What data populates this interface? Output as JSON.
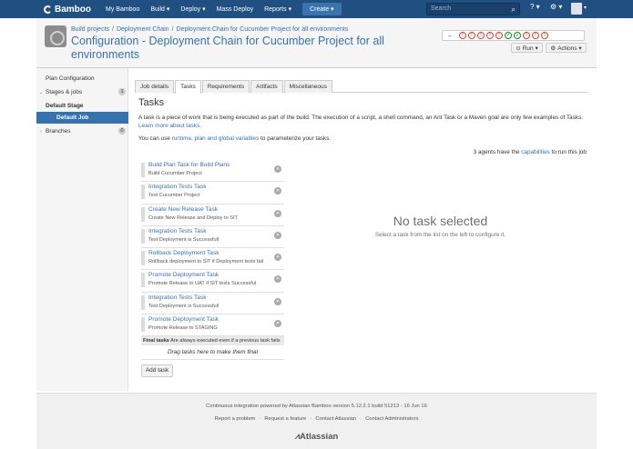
{
  "nav": {
    "logo": "Bamboo",
    "items": [
      "My Bamboo",
      "Build ▾",
      "Deploy ▾",
      "Mass Deploy",
      "Reports ▾"
    ],
    "create_label": "Create ▾",
    "search_placeholder": "Search",
    "help_label": "? ▾",
    "settings_label": "⚙ ▾"
  },
  "header": {
    "breadcrumb": [
      "Build projects",
      "Deployment Chain",
      "Deployment Chain for Cucumber Project for all environments"
    ],
    "title": "Configuration - Deployment Chain for Cucumber Project for all environments",
    "history_statuses": [
      "failed",
      "failed",
      "failed",
      "failed",
      "failed",
      "success",
      "success",
      "failed",
      "failed",
      "failed"
    ],
    "run_label": "Run ▾",
    "actions_label": "Actions ▾"
  },
  "sidebar": {
    "items": [
      {
        "label": "Plan Configuration",
        "badge": ""
      },
      {
        "label": "Stages & jobs",
        "badge": "1"
      },
      {
        "label": "Default Stage",
        "badge": ""
      },
      {
        "label": "Default Job",
        "badge": ""
      },
      {
        "label": "Branches",
        "badge": "0"
      }
    ]
  },
  "tabs": [
    "Job details",
    "Tasks",
    "Requirements",
    "Artifacts",
    "Miscellaneous"
  ],
  "active_tab": "Tasks",
  "main": {
    "title": "Tasks",
    "description": "A task is a piece of work that is being executed as part of the build. The execution of a script, a shell command, an Ant Task or a Maven goal are only few examples of Tasks.",
    "learn_more": "Learn more about tasks.",
    "variables_prefix": "You can use",
    "variables_link": "runtime, plan and global variables",
    "variables_suffix": "to parameterize your tasks.",
    "agents_prefix": "3 agents have the",
    "agents_link": "capabilities",
    "agents_suffix": "to run this job",
    "tasks": [
      {
        "name": "Build Plan Task for Build Plans",
        "desc": "Build Cucumber Project"
      },
      {
        "name": "Integration Tests Task",
        "desc": "Test Cucumber Project"
      },
      {
        "name": "Create New Release Task",
        "desc": "Create New Release and Deploy to SIT"
      },
      {
        "name": "Integration Tests Task",
        "desc": "Test Deployment is Successfull"
      },
      {
        "name": "Rollback Deployment Task",
        "desc": "Rollback deployment to SIT if Deployment tests fail"
      },
      {
        "name": "Promote Deployment Task",
        "desc": "Promote Release to UAT if SIT tests Successful"
      },
      {
        "name": "Integration Tests Task",
        "desc": "Test Deployment is Successfull"
      },
      {
        "name": "Promote Deployment Task",
        "desc": "Promote Release to STAGING"
      }
    ],
    "final_tasks_label": "Final tasks",
    "final_tasks_note": "Are always executed even if a previous task fails",
    "drag_hint": "Drag tasks here to make them final",
    "add_task_label": "Add task",
    "no_task_title": "No task selected",
    "no_task_sub": "Select a task from the list on the left to configure it."
  },
  "footer": {
    "line1": "Continuous integration powered by Atlassian Bamboo version 5.12.2.1 build 51213 - 16 Jun 16",
    "links": [
      "Report a problem",
      "Request a feature",
      "Contact Atlassian",
      "Contact Administrators"
    ],
    "logo": "Atlassian"
  },
  "colors": {
    "nav_bg": "#205081",
    "link": "#3572b0",
    "active_side": "#3572b0",
    "fail": "#d04437",
    "success": "#14892c"
  }
}
